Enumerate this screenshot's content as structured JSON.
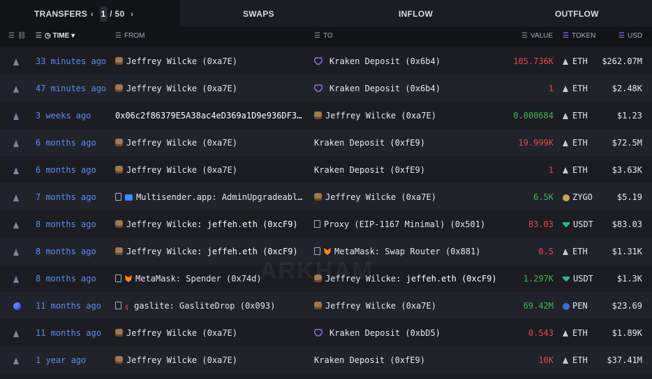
{
  "tabs": {
    "transfers": "TRANSFERS",
    "page_current": "1",
    "page_sep": "/",
    "page_total": "50",
    "swaps": "SWAPS",
    "inflow": "INFLOW",
    "outflow": "OUTFLOW"
  },
  "columns": {
    "time": "TIME",
    "from": "FROM",
    "to": "TO",
    "value": "VALUE",
    "token": "TOKEN",
    "usd": "USD"
  },
  "watermark": "ARKHAM",
  "rows": [
    {
      "time": "33 minutes ago",
      "from": "Jeffrey Wilcke (0xa7E)",
      "to": "Kraken Deposit (0x6b4)",
      "value": "105.736K",
      "token": "ETH",
      "usd": "$262.07M"
    },
    {
      "time": "47 minutes ago",
      "from": "Jeffrey Wilcke (0xa7E)",
      "to": "Kraken Deposit (0x6b4)",
      "value": "1",
      "token": "ETH",
      "usd": "$2.48K"
    },
    {
      "time": "3 weeks ago",
      "from": "0x06c2f86379E5A38ac4eD369a1D9e936DF3…",
      "to": "Jeffrey Wilcke (0xa7E)",
      "value": "0.000684",
      "token": "ETH",
      "usd": "$1.23"
    },
    {
      "time": "6 months ago",
      "from": "Jeffrey Wilcke (0xa7E)",
      "to": "Kraken Deposit (0xfE9)",
      "value": "19.999K",
      "token": "ETH",
      "usd": "$72.5M"
    },
    {
      "time": "6 months ago",
      "from": "Jeffrey Wilcke (0xa7E)",
      "to": "Kraken Deposit (0xfE9)",
      "value": "1",
      "token": "ETH",
      "usd": "$3.63K"
    },
    {
      "time": "7 months ago",
      "from": "Multisender.app: AdminUpgradeabl…",
      "to": "Jeffrey Wilcke (0xa7E)",
      "value": "6.5K",
      "token": "ZYGO",
      "usd": "$5.19"
    },
    {
      "time": "8 months ago",
      "from_name": "Jeffrey Wilcke",
      "from_tail": ": jeffeh.eth (0xcF9)",
      "to": "Proxy (EIP-1167 Minimal) (0x501)",
      "value": "83.03",
      "token": "USDT",
      "usd": "$83.03"
    },
    {
      "time": "8 months ago",
      "from_name": "Jeffrey Wilcke",
      "from_tail": ": jeffeh.eth (0xcF9)",
      "to": "MetaMask: Swap Router (0x881)",
      "value": "0.5",
      "token": "ETH",
      "usd": "$1.31K"
    },
    {
      "time": "8 months ago",
      "from": "MetaMask: Spender (0x74d)",
      "to_name": "Jeffrey Wilcke",
      "to_tail": ": jeffeh.eth (0xcF9)",
      "value": "1.297K",
      "token": "USDT",
      "usd": "$1.3K"
    },
    {
      "time": "11 months ago",
      "from": "gaslite: GasliteDrop (0x093)",
      "to": "Jeffrey Wilcke (0xa7E)",
      "value": "69.42M",
      "token": "PEN",
      "usd": "$23.69"
    },
    {
      "time": "11 months ago",
      "from": "Jeffrey Wilcke (0xa7E)",
      "to": "Kraken Deposit (0xbD5)",
      "value": "0.543",
      "token": "ETH",
      "usd": "$1.89K"
    },
    {
      "time": "1 year ago",
      "from": "Jeffrey Wilcke (0xa7E)",
      "to": "Kraken Deposit (0xfE9)",
      "value": "10K",
      "token": "ETH",
      "usd": "$37.41M"
    }
  ]
}
